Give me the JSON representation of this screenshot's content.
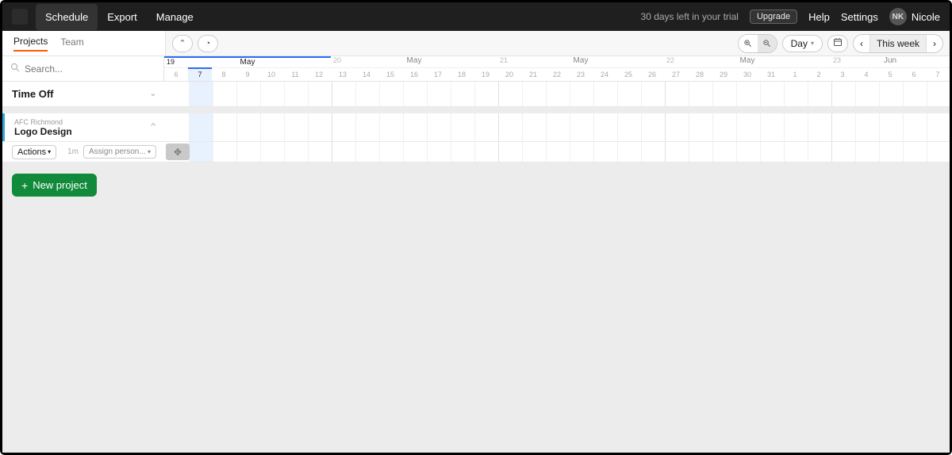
{
  "topbar": {
    "nav": {
      "schedule": "Schedule",
      "export": "Export",
      "manage": "Manage"
    },
    "trial": "30 days left in your trial",
    "upgrade": "Upgrade",
    "help": "Help",
    "settings": "Settings",
    "user": {
      "initials": "NK",
      "name": "Nicole"
    }
  },
  "sidebarTabs": {
    "projects": "Projects",
    "team": "Team"
  },
  "search": {
    "placeholder": "Search..."
  },
  "toolbar": {
    "zoom": "Day",
    "range": "This week"
  },
  "timeline": {
    "weeks": [
      {
        "num": "19",
        "month": "May",
        "days": [
          "6",
          "7",
          "8",
          "9",
          "10",
          "11",
          "12"
        ],
        "current": true,
        "todayIndex": 1
      },
      {
        "num": "20",
        "month": "May",
        "days": [
          "13",
          "14",
          "15",
          "16",
          "17",
          "18",
          "19"
        ]
      },
      {
        "num": "21",
        "month": "May",
        "days": [
          "20",
          "21",
          "22",
          "23",
          "24",
          "25",
          "26"
        ]
      },
      {
        "num": "22",
        "month": "May",
        "days": [
          "27",
          "28",
          "29",
          "30",
          "31",
          "1",
          "2"
        ]
      },
      {
        "num": "23",
        "month": "Jun",
        "days": [
          "3",
          "4",
          "5",
          "6",
          "7"
        ]
      }
    ]
  },
  "sections": {
    "timeoff": "Time Off"
  },
  "project": {
    "client": "AFC Richmond",
    "name": "Logo Design",
    "actions": "Actions",
    "duration": "1m",
    "assignPlaceholder": "Assign person..."
  },
  "newProject": "New project"
}
